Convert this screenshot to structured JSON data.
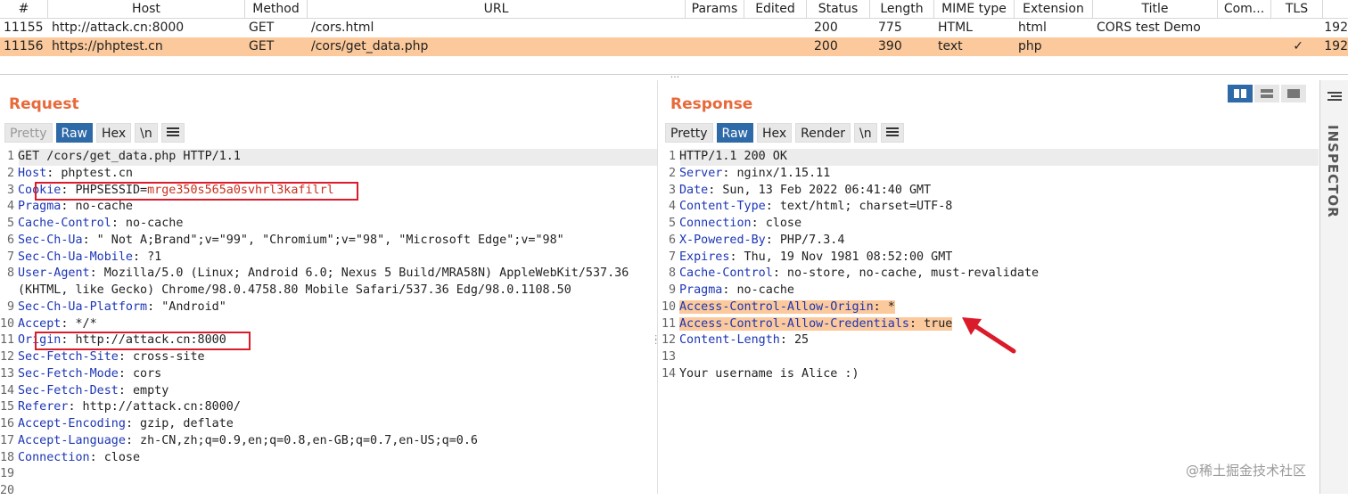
{
  "history": {
    "columns": [
      "#",
      "Host",
      "Method",
      "URL",
      "Params",
      "Edited",
      "Status",
      "Length",
      "MIME type",
      "Extension",
      "Title",
      "Com...",
      "TLS"
    ],
    "rows": [
      {
        "num": "11155",
        "host": "http://attack.cn:8000",
        "method": "GET",
        "url": "/cors.html",
        "params": "",
        "edited": "",
        "status": "200",
        "length": "775",
        "mime": "HTML",
        "ext": "html",
        "title": "CORS test Demo",
        "comment": "",
        "tls": "",
        "extra": "192"
      },
      {
        "num": "11156",
        "host": "https://phptest.cn",
        "method": "GET",
        "url": "/cors/get_data.php",
        "params": "",
        "edited": "",
        "status": "200",
        "length": "390",
        "mime": "text",
        "ext": "php",
        "title": "",
        "comment": "",
        "tls": "✓",
        "extra": "192"
      }
    ]
  },
  "request": {
    "title": "Request",
    "tabs": [
      "Pretty",
      "Raw",
      "Hex",
      "\\n"
    ],
    "lines": [
      {
        "n": "1",
        "name": "",
        "text": "GET /cors/get_data.php HTTP/1.1"
      },
      {
        "n": "2",
        "name": "Host",
        "text": ": phptest.cn"
      },
      {
        "n": "3",
        "name": "Cookie",
        "text": ": PHPSESSID=",
        "value": "mrge350s565a0svhrl3kafilrl"
      },
      {
        "n": "4",
        "name": "Pragma",
        "text": ": no-cache"
      },
      {
        "n": "5",
        "name": "Cache-Control",
        "text": ": no-cache"
      },
      {
        "n": "6",
        "name": "Sec-Ch-Ua",
        "text": ": \" Not A;Brand\";v=\"99\", \"Chromium\";v=\"98\", \"Microsoft Edge\";v=\"98\""
      },
      {
        "n": "7",
        "name": "Sec-Ch-Ua-Mobile",
        "text": ": ?1"
      },
      {
        "n": "8",
        "name": "User-Agent",
        "text": ": Mozilla/5.0 (Linux; Android 6.0; Nexus 5 Build/MRA58N) AppleWebKit/537.36"
      },
      {
        "n": "",
        "name": "",
        "text": "(KHTML, like Gecko) Chrome/98.0.4758.80 Mobile Safari/537.36 Edg/98.0.1108.50"
      },
      {
        "n": "9",
        "name": "Sec-Ch-Ua-Platform",
        "text": ": \"Android\""
      },
      {
        "n": "10",
        "name": "Accept",
        "text": ": */*"
      },
      {
        "n": "11",
        "name": "Origin",
        "text": ": http://attack.cn:8000"
      },
      {
        "n": "12",
        "name": "Sec-Fetch-Site",
        "text": ": cross-site"
      },
      {
        "n": "13",
        "name": "Sec-Fetch-Mode",
        "text": ": cors"
      },
      {
        "n": "14",
        "name": "Sec-Fetch-Dest",
        "text": ": empty"
      },
      {
        "n": "15",
        "name": "Referer",
        "text": ": http://attack.cn:8000/"
      },
      {
        "n": "16",
        "name": "Accept-Encoding",
        "text": ": gzip, deflate"
      },
      {
        "n": "17",
        "name": "Accept-Language",
        "text": ": zh-CN,zh;q=0.9,en;q=0.8,en-GB;q=0.7,en-US;q=0.6"
      },
      {
        "n": "18",
        "name": "Connection",
        "text": ": close"
      },
      {
        "n": "19",
        "name": "",
        "text": ""
      },
      {
        "n": "20",
        "name": "",
        "text": ""
      }
    ]
  },
  "response": {
    "title": "Response",
    "tabs": [
      "Pretty",
      "Raw",
      "Hex",
      "Render",
      "\\n"
    ],
    "lines": [
      {
        "n": "1",
        "name": "",
        "text": "HTTP/1.1 200 OK"
      },
      {
        "n": "2",
        "name": "Server",
        "text": ": nginx/1.15.11"
      },
      {
        "n": "3",
        "name": "Date",
        "text": ": Sun, 13 Feb 2022 06:41:40 GMT"
      },
      {
        "n": "4",
        "name": "Content-Type",
        "text": ": text/html; charset=UTF-8"
      },
      {
        "n": "5",
        "name": "Connection",
        "text": ": close"
      },
      {
        "n": "6",
        "name": "X-Powered-By",
        "text": ": PHP/7.3.4"
      },
      {
        "n": "7",
        "name": "Expires",
        "text": ": Thu, 19 Nov 1981 08:52:00 GMT"
      },
      {
        "n": "8",
        "name": "Cache-Control",
        "text": ": no-store, no-cache, must-revalidate"
      },
      {
        "n": "9",
        "name": "Pragma",
        "text": ": no-cache"
      },
      {
        "n": "10",
        "name": "Access-Control-Allow-Origin",
        "text": ": *",
        "hl": true
      },
      {
        "n": "11",
        "name": "Access-Control-Allow-Credentials",
        "text": ": true",
        "hl": true
      },
      {
        "n": "12",
        "name": "Content-Length",
        "text": ": 25"
      },
      {
        "n": "13",
        "name": "",
        "text": ""
      },
      {
        "n": "14",
        "name": "",
        "text": "Your username is Alice :)"
      }
    ]
  },
  "inspector": {
    "label": "INSPECTOR"
  },
  "watermark": "@稀土掘金技术社区",
  "colors": {
    "accent": "#e8693a",
    "selected_row": "#fbc99b",
    "header_name": "#1c36b5",
    "annotation": "#d91b2a",
    "active_tab": "#2f6aa8"
  }
}
